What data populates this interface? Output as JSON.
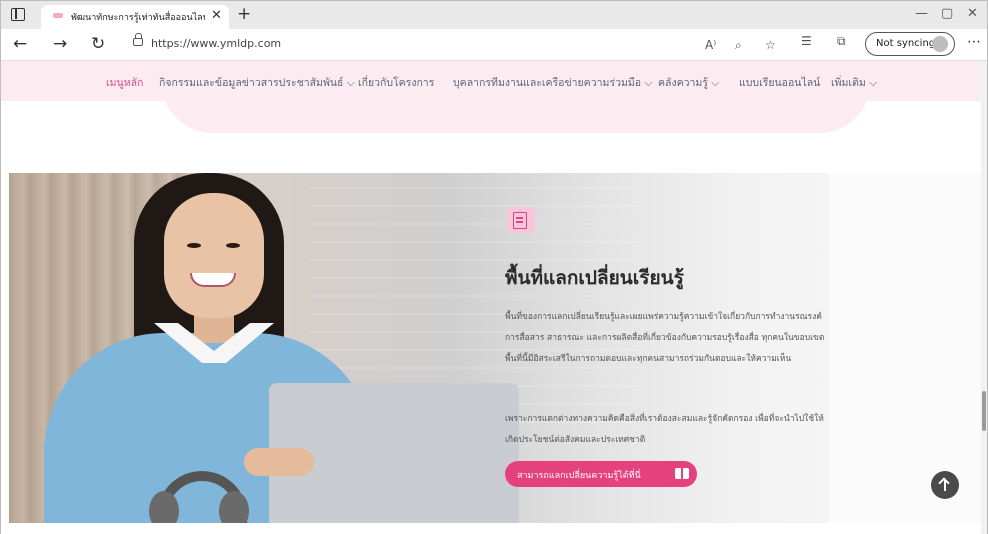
{
  "browser": {
    "tab_title": "พัฒนาทักษะการรู้เท่าทันสื่อออนไลน์ ไข",
    "url": "https://www.ymldp.com",
    "sync_label": "Not syncing"
  },
  "menu": {
    "items": [
      "เมนูหลัก",
      "กิจกรรมและข้อมูลข่าวสารประชาสัมพันธ์ ⌵",
      "เกี่ยวกับโครงการ",
      "บุคลากรทีมงานและเครือข่ายความร่วมมือ ⌵",
      "คลังความรู้ ⌵",
      "แบบเรียนออนไลน์",
      "เพิ่มเติม ⌵"
    ]
  },
  "hero": {
    "heading": "พื้นที่แลกเปลี่ยนเรียนรู้",
    "para1": "พื้นที่ของการแลกเปลี่ยนเรียนรู้และเผยแพร่ความรู้ความเข้าใจเกี่ยวกับการทำงานรณรงค์ การสื่อสาร สาธารณะ และการผลิตสื่อที่เกี่ยวข้องกับความรอบรู้เรื่องสื่อ ทุกคนในขอบเขตพื้นที่นี้มีอิสระเสรีในการถามตอบและทุกคนสามารถร่วมกันตอบและให้ความเห็น",
    "para2": "เพราะการแตกต่างทางความคิดคือสิ่งที่เราต้องสะสมและรู้จักคัดกรอง เพื่อที่จะนำไปใช้ให้เกิดประโยชน์ต่อสังคมและประเทศชาติ",
    "cta": "สามารถแลกเปลี่ยนความรู้ได้ที่นี่"
  },
  "icons": [
    "tab-actions-icon",
    "favicon-icon",
    "close-icon",
    "plus-icon",
    "minimize-icon",
    "maximize-icon",
    "back-icon",
    "forward-icon",
    "refresh-icon",
    "lock-icon",
    "read-aloud-icon",
    "zoom-icon",
    "favorite-icon",
    "favorites-icon",
    "collections-icon",
    "profile-icon",
    "more-icon",
    "document-icon",
    "book-icon",
    "arrow-up-icon"
  ],
  "colors": {
    "accent": "#e5427d",
    "menu_bg": "#fcecf2",
    "active_menu": "#d6488b"
  }
}
